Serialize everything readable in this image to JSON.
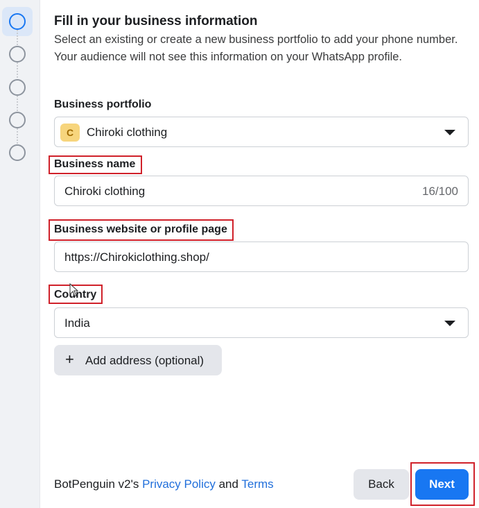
{
  "stepper": {
    "steps": [
      {
        "state": "active"
      },
      {
        "state": "inactive"
      },
      {
        "state": "inactive"
      },
      {
        "state": "inactive"
      },
      {
        "state": "inactive"
      }
    ]
  },
  "header": {
    "title": "Fill in your business information",
    "description": "Select an existing or create a new business portfolio to add your phone number. Your audience will not see this information on your WhatsApp profile."
  },
  "form": {
    "portfolio": {
      "label": "Business portfolio",
      "avatar_letter": "C",
      "value": "Chiroki clothing"
    },
    "business_name": {
      "label": "Business name",
      "value": "Chiroki clothing",
      "counter": "16/100"
    },
    "website": {
      "label": "Business website or profile page",
      "value": "https://Chirokiclothing.shop/"
    },
    "country": {
      "label": "Country",
      "value": "India"
    },
    "add_address_label": "Add address (optional)"
  },
  "footer": {
    "prefix": "BotPenguin v2's ",
    "privacy_link": "Privacy Policy",
    "and": " and ",
    "terms_link": "Terms",
    "back_label": "Back",
    "next_label": "Next"
  },
  "colors": {
    "accent": "#1877f2",
    "highlight": "#d0212a",
    "link": "#216fdb"
  }
}
